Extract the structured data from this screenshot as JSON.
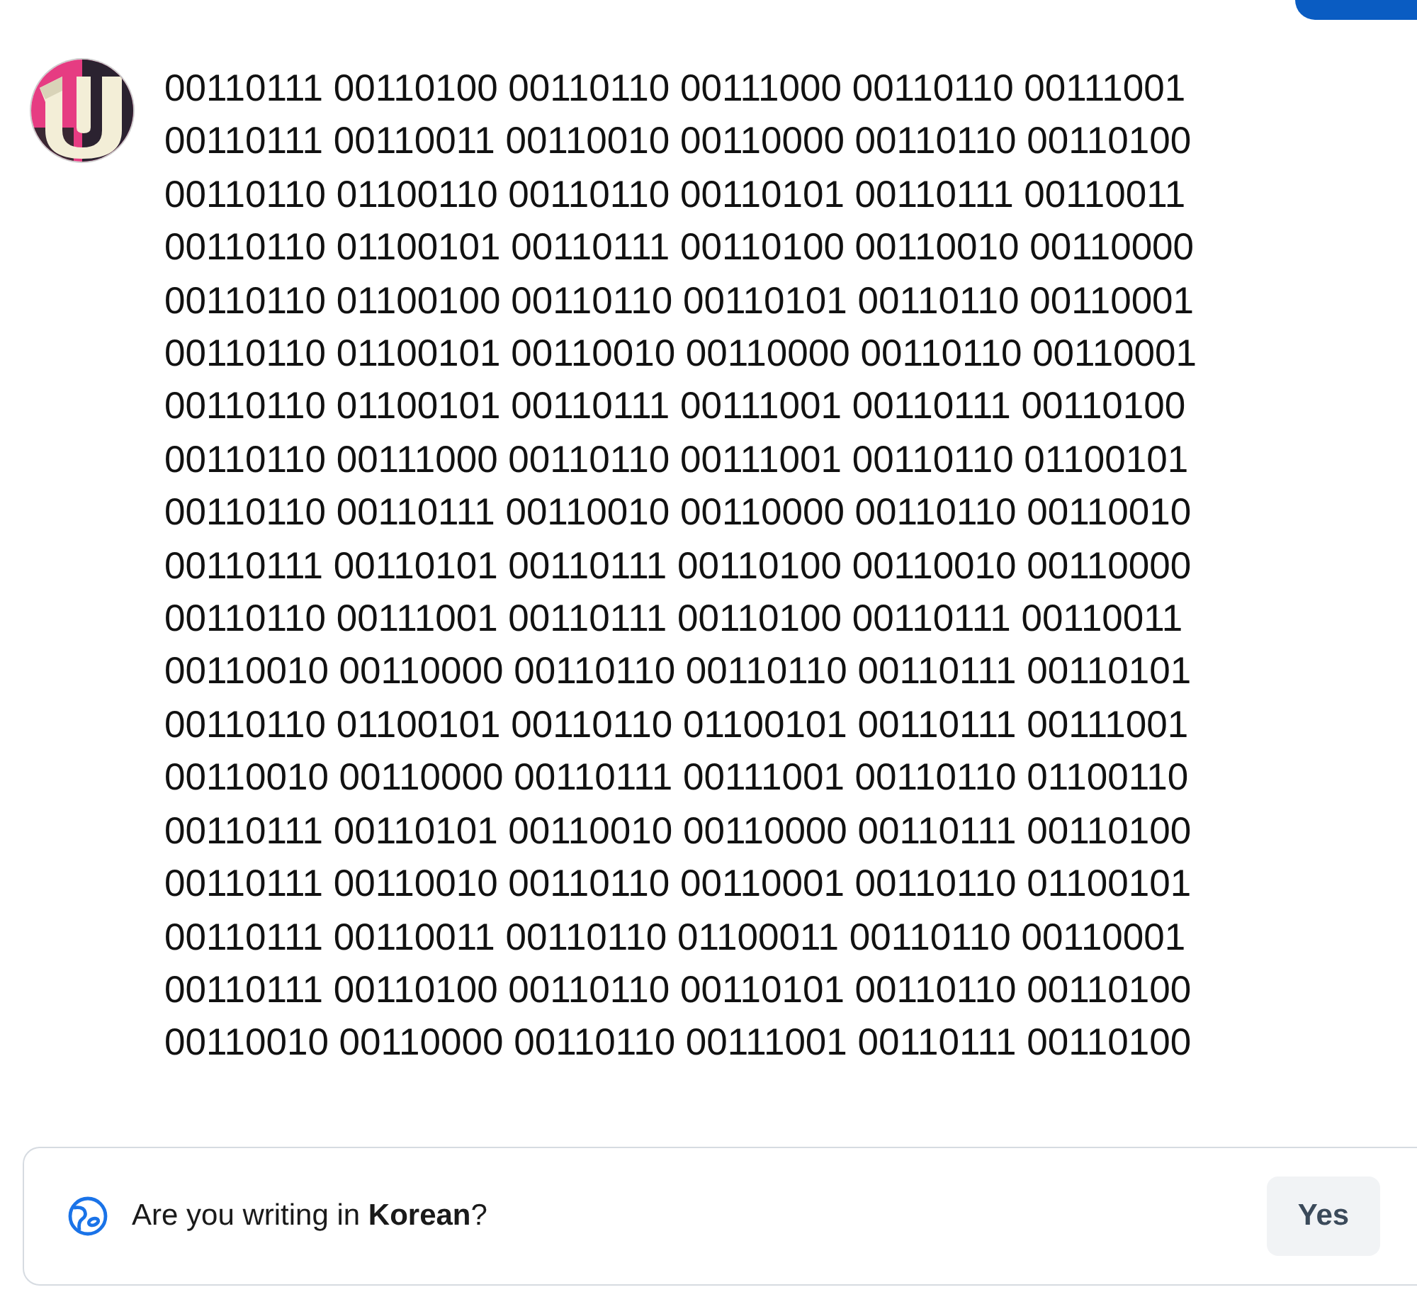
{
  "message": {
    "lines": [
      "00110111 00110100 00110110 00111000 00110110 00111001",
      "00110111 00110011 00110010 00110000 00110110 00110100",
      "00110110 01100110 00110110 00110101 00110111 00110011",
      "00110110 01100101 00110111 00110100 00110010 00110000",
      "00110110 01100100 00110110 00110101 00110110 00110001",
      "00110110 01100101 00110010 00110000 00110110 00110001",
      "00110110 01100101 00110111 00111001 00110111 00110100",
      "00110110 00111000 00110110 00111001 00110110 01100101",
      "00110110 00110111 00110010 00110000 00110110 00110010",
      "00110111 00110101 00110111 00110100 00110010 00110000",
      "00110110 00111001 00110111 00110100 00110111 00110011",
      "00110010 00110000 00110110 00110110 00110111 00110101",
      "00110110 01100101 00110110 01100101 00110111 00111001",
      "00110010 00110000 00110111 00111001 00110110 01100110",
      "00110111 00110101 00110010 00110000 00110111 00110100",
      "00110111 00110010 00110110 00110001 00110110 01100101",
      "00110111 00110011 00110110 01100011 00110110 00110001",
      "00110111 00110100 00110110 00110101 00110110 00110100",
      "00110010 00110000 00110110 00111001 00110111 00110100"
    ]
  },
  "language_prompt": {
    "text": "Are you writing in **Korean**?",
    "button": "Yes"
  }
}
